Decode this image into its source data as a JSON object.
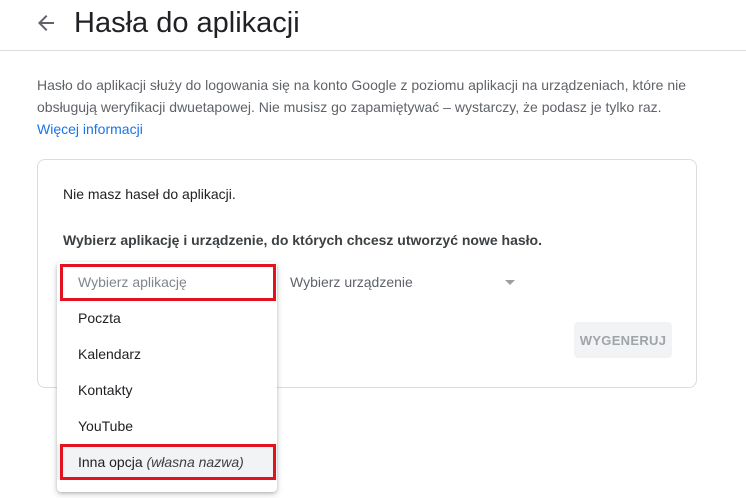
{
  "header": {
    "title": "Hasła do aplikacji"
  },
  "description": {
    "text": "Hasło do aplikacji służy do logowania się na konto Google z poziomu aplikacji na urządzeniach, które nie obsługują weryfikacji dwuetapowej. Nie musisz go zapamiętywać – wystarczy, że podasz je tylko raz.",
    "link": "Więcej informacji"
  },
  "card": {
    "no_passwords": "Nie masz haseł do aplikacji.",
    "choose_prompt": "Wybierz aplikację i urządzenie, do których chcesz utworzyć nowe hasło.",
    "device_select": "Wybierz urządzenie",
    "generate_button": "WYGENERUJ"
  },
  "app_dropdown": {
    "placeholder": "Wybierz aplikację",
    "options": [
      "Poczta",
      "Kalendarz",
      "Kontakty",
      "YouTube"
    ],
    "custom_option": "Inna opcja",
    "custom_hint": "(własna nazwa)"
  },
  "colors": {
    "highlight": "#e3121f",
    "link": "#1a73e8"
  }
}
